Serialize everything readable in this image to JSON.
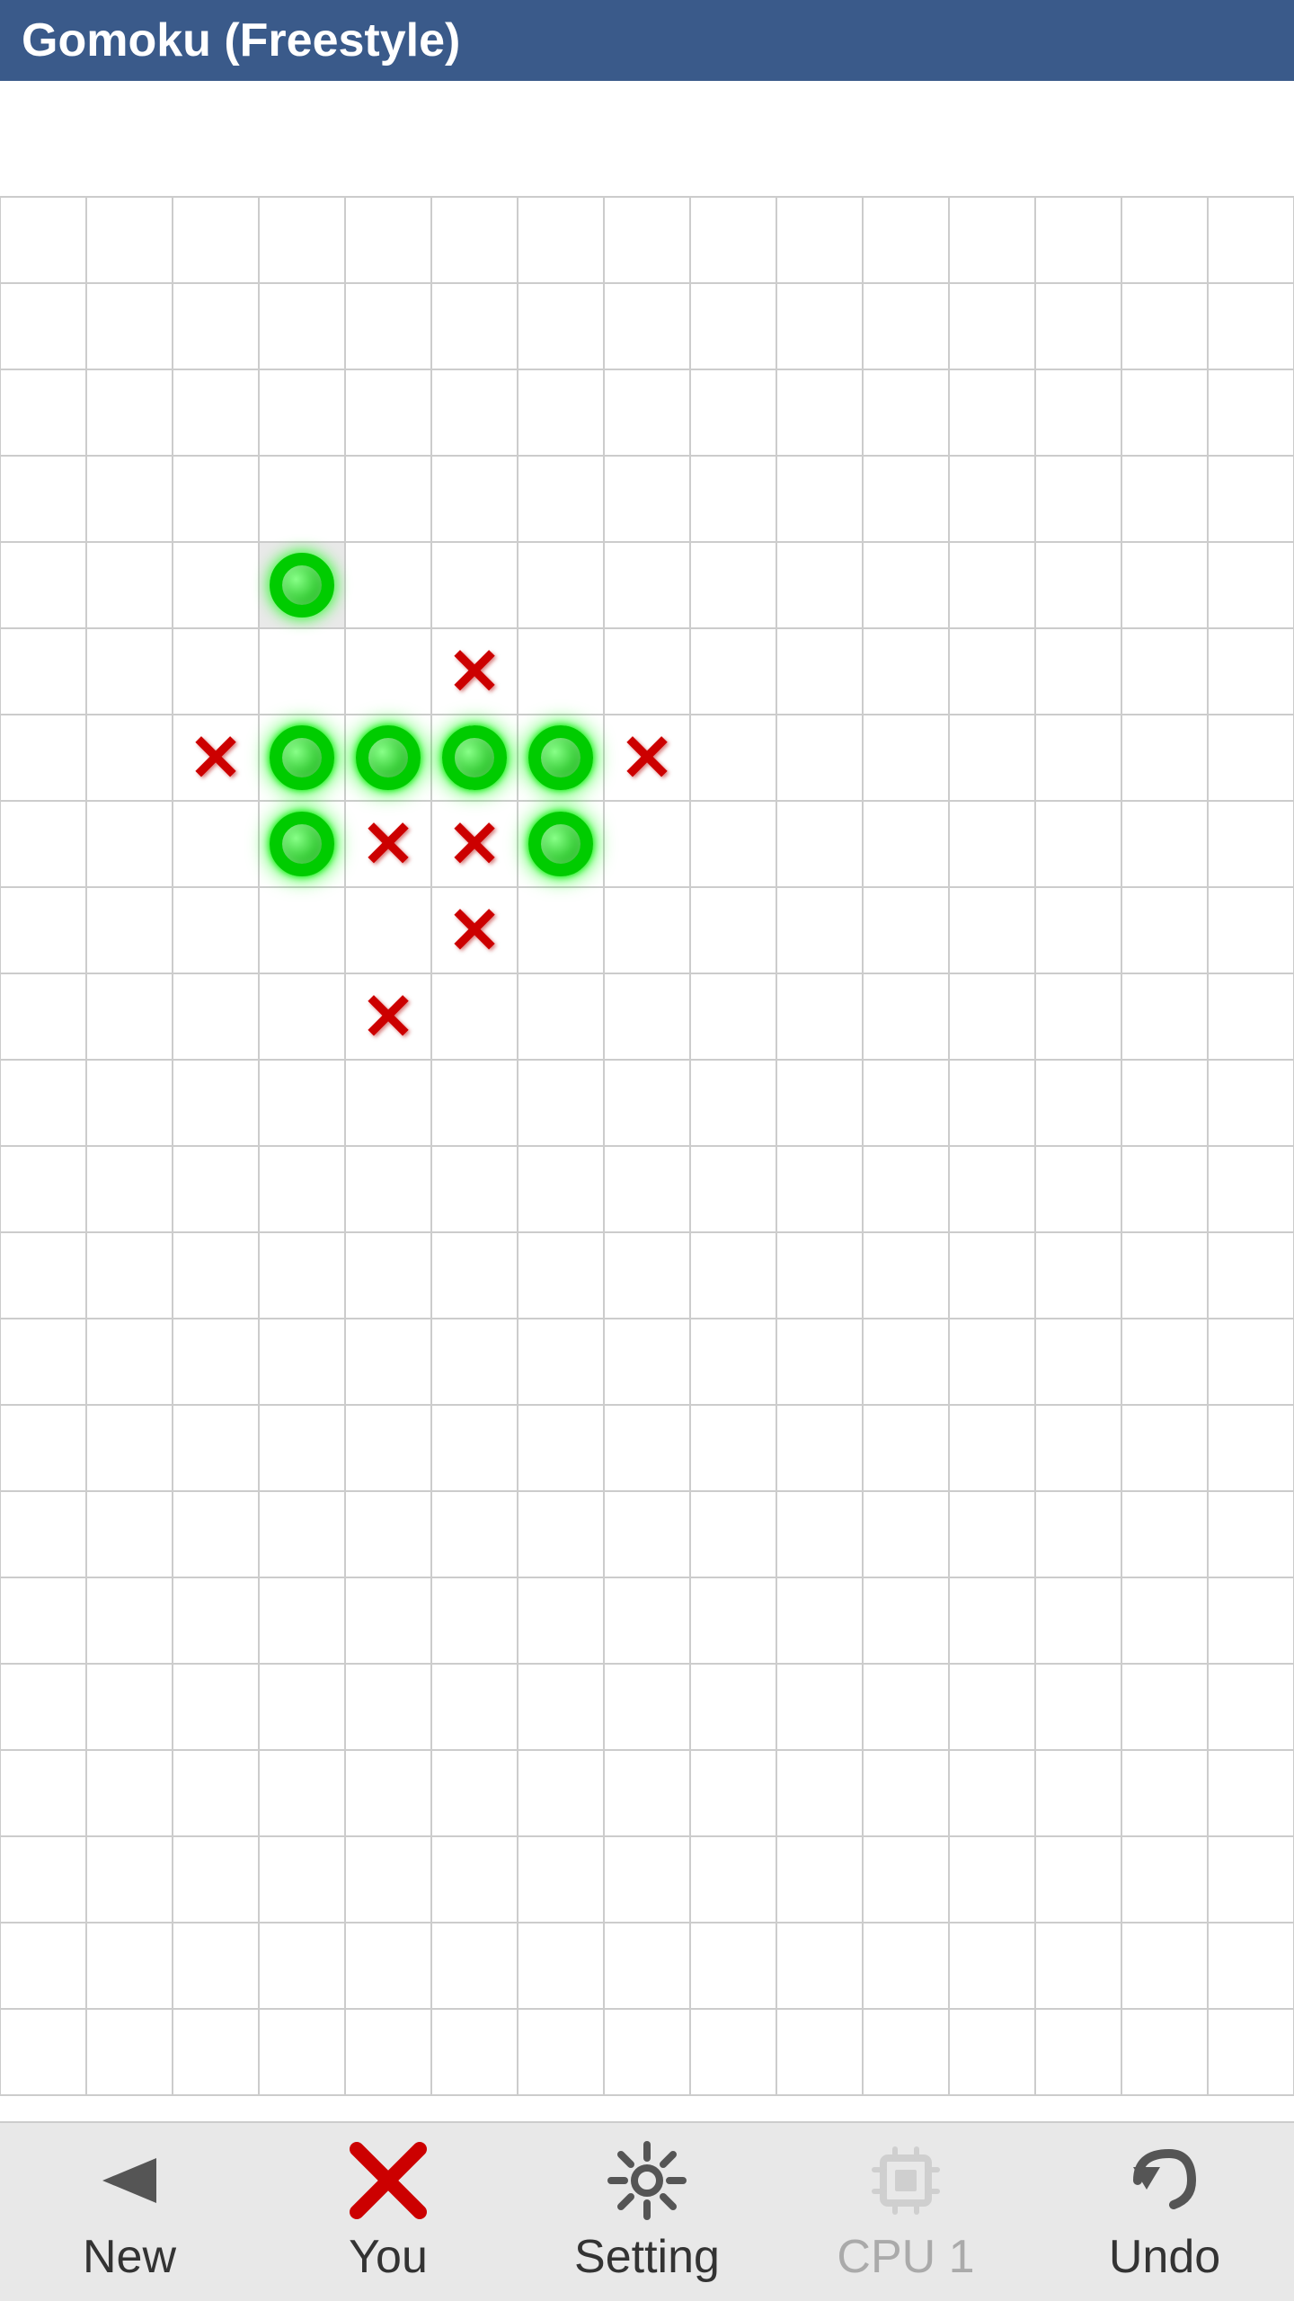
{
  "title": "Gomoku (Freestyle)",
  "board": {
    "cols": 15,
    "rows": 22,
    "cell_size": 96,
    "offset_x": 0,
    "offset_y": 0
  },
  "pieces": [
    {
      "type": "O",
      "col": 3,
      "row": 4,
      "highlighted": true
    },
    {
      "type": "X",
      "col": 5,
      "row": 5,
      "highlighted": false
    },
    {
      "type": "X",
      "col": 2,
      "row": 6,
      "highlighted": false
    },
    {
      "type": "O",
      "col": 3,
      "row": 6,
      "highlighted": false
    },
    {
      "type": "O",
      "col": 4,
      "row": 6,
      "highlighted": false
    },
    {
      "type": "O",
      "col": 5,
      "row": 6,
      "highlighted": false
    },
    {
      "type": "O",
      "col": 6,
      "row": 6,
      "highlighted": false
    },
    {
      "type": "X",
      "col": 7,
      "row": 6,
      "highlighted": false
    },
    {
      "type": "O",
      "col": 3,
      "row": 7,
      "highlighted": false
    },
    {
      "type": "X",
      "col": 4,
      "row": 7,
      "highlighted": false
    },
    {
      "type": "X",
      "col": 5,
      "row": 7,
      "highlighted": false
    },
    {
      "type": "O",
      "col": 6,
      "row": 7,
      "highlighted": false
    },
    {
      "type": "X",
      "col": 5,
      "row": 8,
      "highlighted": false
    },
    {
      "type": "X",
      "col": 4,
      "row": 9,
      "highlighted": false
    }
  ],
  "bottom_bar": {
    "buttons": [
      {
        "id": "new",
        "label": "New",
        "icon": "arrow-new",
        "enabled": true
      },
      {
        "id": "you",
        "label": "You",
        "icon": "x-mark",
        "enabled": true
      },
      {
        "id": "setting",
        "label": "Setting",
        "icon": "gear",
        "enabled": true
      },
      {
        "id": "cpu1",
        "label": "CPU 1",
        "icon": "cpu",
        "enabled": false
      },
      {
        "id": "undo",
        "label": "Undo",
        "icon": "arrow-undo",
        "enabled": true
      }
    ]
  }
}
